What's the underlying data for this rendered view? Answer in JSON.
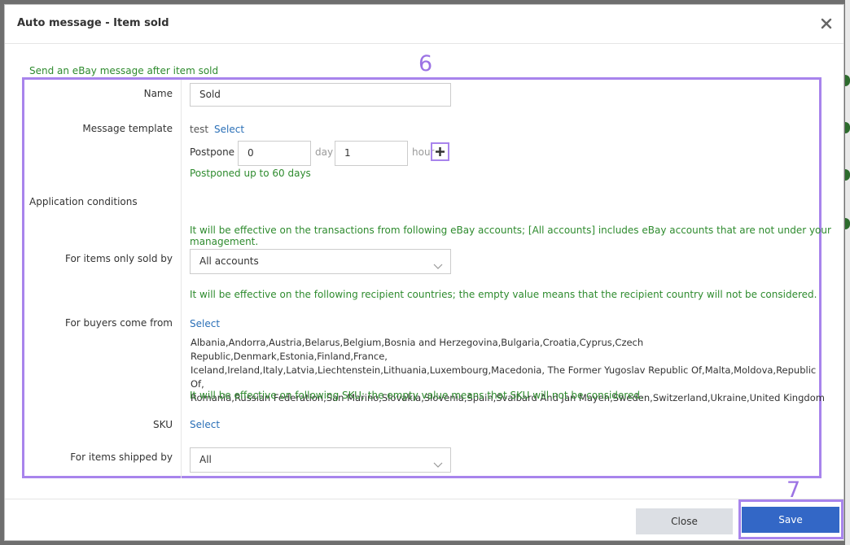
{
  "dialog": {
    "title": "Auto message - Item sold",
    "intro": "Send an eBay message after item sold"
  },
  "annotations": {
    "step_six": "6",
    "step_seven": "7"
  },
  "form": {
    "name": {
      "label": "Name",
      "value": "Sold"
    },
    "message_template": {
      "label": "Message template",
      "current": "test",
      "select_link": "Select",
      "postpone_label": "Postpone",
      "day_value": "0",
      "day_unit": "day",
      "hour_value": "1",
      "hour_unit": "hour",
      "postpone_note": "Postponed up to 60 days"
    },
    "application_conditions": "Application conditions",
    "accounts": {
      "note": "It will be effective on the transactions from following eBay accounts; [All accounts] includes eBay accounts that are not under your management.",
      "label": "For items only sold by",
      "selected": "All accounts"
    },
    "countries": {
      "note": "It will be effective on the following recipient countries; the empty value means that the recipient country will not be considered.",
      "label": "For buyers come from",
      "select_link": "Select",
      "list": [
        "Albania,Andorra,Austria,Belarus,Belgium,Bosnia and Herzegovina,Bulgaria,Croatia,Cyprus,Czech Republic,Denmark,Estonia,Finland,France,",
        "Iceland,Ireland,Italy,Latvia,Liechtenstein,Lithuania,Luxembourg,Macedonia, The Former Yugoslav Republic Of,Malta,Moldova,Republic Of,",
        "Romania,Russian Federation,San Marino,Slovakia,Slovenia,Spain,Svalbard And Jan Mayen,Sweden,Switzerland,Ukraine,United Kingdom"
      ]
    },
    "sku": {
      "note": "It will be effective on following SKU; the empty value means that SKU will not be considered.",
      "label": "SKU",
      "select_link": "Select"
    },
    "shipping": {
      "label": "For items shipped by",
      "selected": "All"
    }
  },
  "footer": {
    "close_label": "Close",
    "save_label": "Save"
  },
  "colors": {
    "accent": "#3367c6",
    "annotation": "#a884ec",
    "note_green": "#2e8b2e",
    "link": "#2a6fb7"
  },
  "icons": {
    "close": "close-x-icon",
    "plus": "plus-icon",
    "dropdown": "chevron-down-icon"
  }
}
